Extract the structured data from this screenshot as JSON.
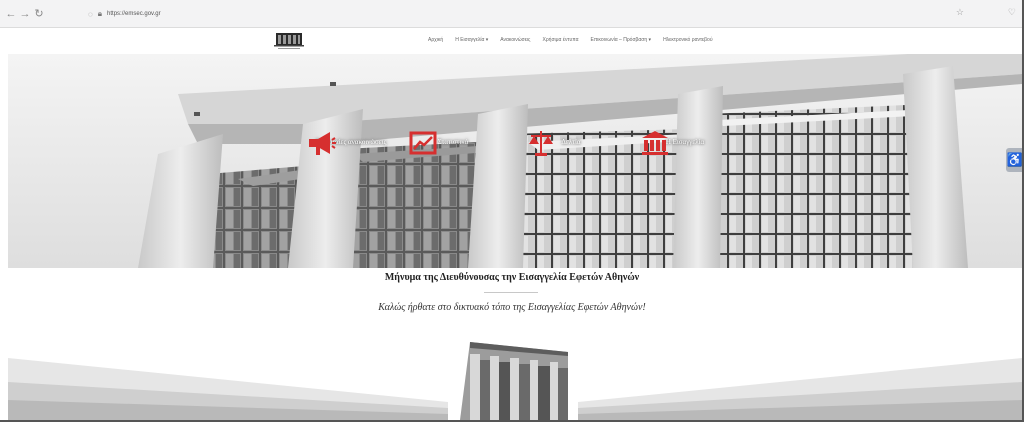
{
  "browser": {
    "url": "https://emsec.gov.gr",
    "icons": [
      "back-arrow-icon",
      "forward-arrow-icon",
      "reload-icon",
      "shield-icon",
      "lock-icon",
      "reader-icon",
      "extension-icon"
    ]
  },
  "header": {
    "logo": "court-building-logo",
    "menu": [
      "Αρχική",
      "Η Εισαγγελία ▾",
      "Ανακοινώσεις",
      "Χρήσιμα έντυπα",
      "Επικοινωνία – Πρόσβαση ▾",
      "Ηλεκτρονικό ραντεβού"
    ]
  },
  "hero": {
    "links": [
      {
        "label": "Τελευταίες ανακοινώσεις",
        "icon": "megaphone-icon"
      },
      {
        "label": "Στατιστικά",
        "icon": "chart-icon"
      },
      {
        "label": "Δελτία",
        "icon": "scales-icon"
      },
      {
        "label": "Η Εισαγγελία",
        "icon": "courthouse-icon"
      }
    ],
    "accent_color": "#d62f2f",
    "accessibility_icon": "wheelchair-icon",
    "accessibility_glyph": "♿"
  },
  "message": {
    "title": "Μήνυμα της Διευθύνουσας την Εισαγγελία Εφετών Αθηνών",
    "welcome": "Καλώς ήρθατε στο δικτυακό τόπο της Εισαγγελίας Εφετών Αθηνών!"
  }
}
